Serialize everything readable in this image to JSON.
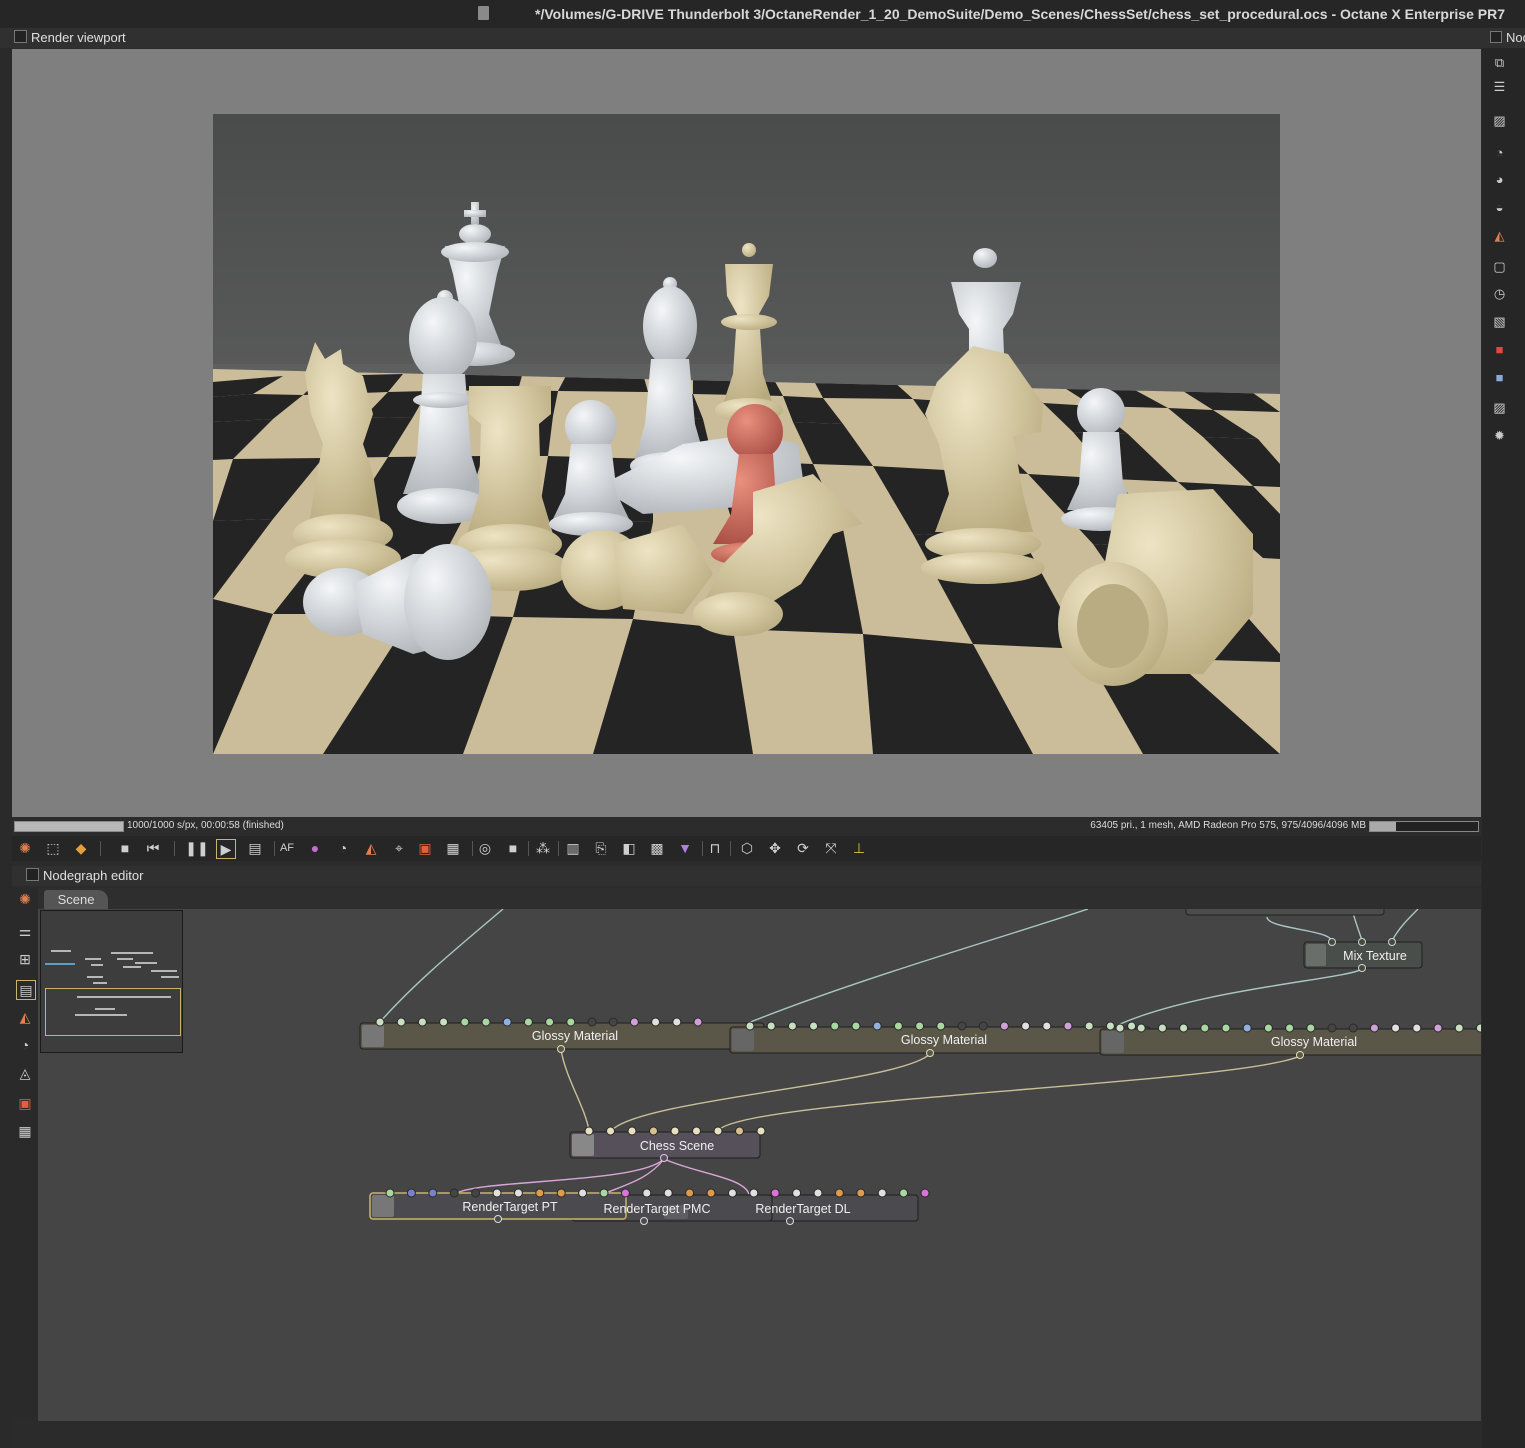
{
  "window": {
    "title": "*/Volumes/G-DRIVE Thunderbolt 3/OctaneRender_1_20_DemoSuite/Demo_Scenes/ChessSet/chess_set_procedural.ocs - Octane X Enterprise PR7"
  },
  "render_viewport": {
    "panel_title": "Render viewport",
    "progress_text": "1000/1000 s/px, 00:00:58 (finished)",
    "progress_fraction": 1.0,
    "stats_text": "63405 pri., 1 mesh, AMD Radeon Pro 575, 975/4096/4096 MB",
    "memory_fraction": 0.24
  },
  "toolbar": {
    "buttons": [
      "octane-logo-icon",
      "region-icon",
      "cube-icon",
      "stop-icon",
      "restart-icon",
      "pause-icon",
      "play-icon",
      "preview-icon",
      "aov-icon",
      "color-picker-icon",
      "focus-picker-icon",
      "material-picker-icon",
      "object-picker-icon",
      "render-region-icon",
      "film-region-icon",
      "snapshot-icon",
      "clay-mode-icon",
      "lock-icon",
      "viewport-resolution-icon",
      "copy-icon",
      "save-icon",
      "layers-icon",
      "checker-icon",
      "triangle-icon",
      "unlock-icon",
      "box-icon",
      "move-icon",
      "rotate-icon",
      "scale-icon",
      "axis-icon"
    ]
  },
  "nodegraph": {
    "panel_title": "Nodegraph editor",
    "tab": "Scene",
    "nodes": {
      "glossy_1": "Glossy Material",
      "glossy_2": "Glossy Material",
      "glossy_3": "Glossy Material",
      "mix_texture": "Mix Texture",
      "chess_scene": "Chess Scene",
      "rt_pt": "RenderTarget PT",
      "rt_pmc": "RenderTarget PMC",
      "rt_dl": "RenderTarget DL"
    }
  },
  "right_panel": {
    "header": "Nod"
  },
  "colors": {
    "node_material": "#5a5648",
    "node_texture": "#4a4e4b",
    "node_scene": "#55505a",
    "node_rendertarget": "#4b4b4f",
    "wire_material": "#c8c09a",
    "wire_texture": "#a9c6c4",
    "wire_scene": "#d9a6d8",
    "selection": "#c8b46a"
  }
}
